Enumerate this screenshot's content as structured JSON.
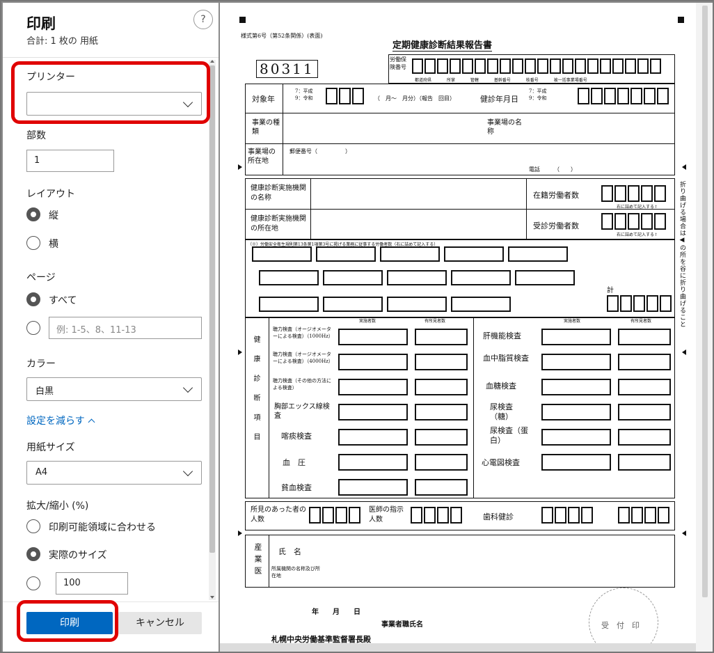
{
  "dialog": {
    "title": "印刷",
    "subtitle": "合計: 1 枚の 用紙",
    "help": "?",
    "printer": {
      "label": "プリンター",
      "value": ""
    },
    "copies": {
      "label": "部数",
      "value": "1"
    },
    "layout": {
      "label": "レイアウト",
      "options": [
        "縦",
        "横"
      ],
      "selected": "縦"
    },
    "pages": {
      "label": "ページ",
      "all": "すべて",
      "placeholder": "例: 1-5、8、11-13"
    },
    "color": {
      "label": "カラー",
      "value": "白黒"
    },
    "fewer_settings": "設定を減らす",
    "paper_size": {
      "label": "用紙サイズ",
      "value": "A4"
    },
    "scale": {
      "label": "拡大/縮小 (%)",
      "options": [
        "印刷可能領域に合わせる",
        "実際のサイズ"
      ],
      "selected": "実際のサイズ",
      "custom_value": "100"
    },
    "print_button": "印刷",
    "cancel_button": "キャンセル"
  },
  "highlight_color": "#e00000",
  "preview": {
    "form_no": "様式第6号（第52条関係）(表面)",
    "form_title": "定期健康診断結果報告書",
    "code": "80311",
    "labor_insurance": "労働保険番号",
    "insurance_sub": [
      "都道府県",
      "所掌",
      "管轄",
      "基幹番号",
      "枝番号",
      "被一括事業場番号"
    ],
    "target_year": "対象年",
    "era_options": "7：平成\n9：令和",
    "month_note": "（　月～　月分）（報告　回目）",
    "exam_date": "健診年月日",
    "business_type": "事業の種類",
    "workplace_name": "事業場の名称",
    "workplace_addr": "事業場の所在地",
    "postal": "郵便番号（　　　　　）",
    "phone": "電話　　　（　　）",
    "clinic_name": "健康診断実施機関の名称",
    "clinic_addr": "健康診断実施機関の所在地",
    "enrolled": "在籍労働者数",
    "examined": "受診労働者数",
    "right_note": "右に詰めて記入する↑",
    "harmful_note": "（※）労働安全衛生規則第13条第1項第3号に掲げる業務に従事する労働者数（右に詰めて記入する）",
    "total": "計",
    "exam_items_label": "健康診断項目",
    "implemented": "実施者数",
    "with_findings": "有所見者数",
    "left_items": [
      "聴力検査（オージオメーターによる検査）（1000Hz）",
      "聴力検査（オージオメーターによる検査）（4000Hz）",
      "聴力検査（その他の方法による検査）",
      "胸部エックス線検査",
      "喀痰検査",
      "血　圧",
      "貧血検査"
    ],
    "right_items": [
      "肝機能検査",
      "血中脂質検査",
      "血糖検査",
      "尿検査（糖）",
      "尿検査（蛋白）",
      "心電図検査"
    ],
    "findings_doctor": "所見のあった者の人数",
    "doctor_instructions": "医師の指示人数",
    "dental": "歯科健診",
    "occupational_physician": "産業医",
    "name": "氏　名",
    "affiliation": "所属機関の名称及び所在地",
    "date": "年　　月　　日",
    "employer": "事業者職氏名",
    "office": "札幌中央労働基準監督署長殿",
    "received": "受　付　印",
    "fold_note": "折り曲げる場合は◀の所を谷に折り曲げること"
  }
}
